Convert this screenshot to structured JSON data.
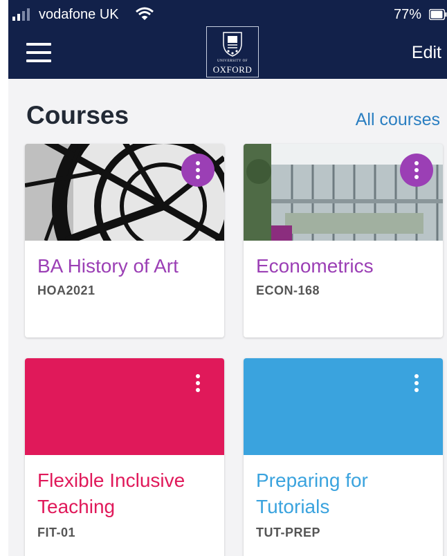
{
  "status_bar": {
    "carrier": "vodafone UK",
    "battery_percent": "77%"
  },
  "header": {
    "logo_small_text": "UNIVERSITY OF",
    "logo_big_text": "OXFORD",
    "edit_label": "Edit"
  },
  "courses_section": {
    "title": "Courses",
    "all_courses_label": "All courses"
  },
  "courses": [
    {
      "title": "BA History of Art",
      "code": "HOA2021",
      "color": "#9b3fb5",
      "banner": "image-clock",
      "kebab_bg": "#9b3fb5"
    },
    {
      "title": "Econometrics",
      "code": "ECON-168",
      "color": "#9b3fb5",
      "banner": "image-building",
      "kebab_bg": "#9b3fb5"
    },
    {
      "title": "Flexible Inclusive Teaching",
      "code": "FIT-01",
      "color": "#e0195a",
      "banner_color": "#e0195a"
    },
    {
      "title": "Preparing for Tutorials",
      "code": "TUT-PREP",
      "color": "#3aa3de",
      "banner_color": "#3aa3de"
    }
  ],
  "colors": {
    "header_bg": "#12214a",
    "link_blue": "#2a7ec1",
    "purple": "#9b3fb5",
    "pink": "#e0195a",
    "sky": "#3aa3de"
  }
}
